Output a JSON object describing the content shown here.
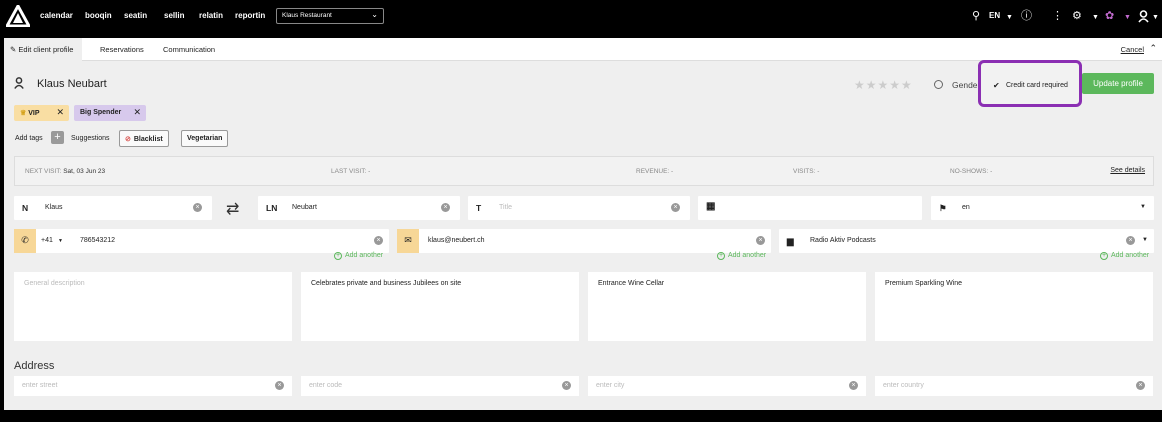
{
  "nav": {
    "items": [
      "calendar",
      "booqin",
      "seatin",
      "sellin",
      "relatin",
      "reportin"
    ],
    "restaurant": "Klaus Restaurant",
    "language": "EN",
    "icons": [
      "search-icon",
      "info-icon",
      "more-vertical-icon",
      "settings-icon",
      "flower-icon",
      "user-icon"
    ]
  },
  "tabs": {
    "edit": "Edit client profile",
    "reservations": "Reservations",
    "communication": "Communication",
    "cancel": "Cancel"
  },
  "client": {
    "name": "Klaus Neubart",
    "gender_label": "Gende",
    "credit_card_label": "Credit card required",
    "update_label": "Update profile",
    "rating": 0
  },
  "tags": {
    "items": [
      "VIP",
      "Big Spender"
    ],
    "add_label": "Add tags",
    "suggestions_label": "Suggestions",
    "suggestions": [
      "Blacklist",
      "Vegetarian"
    ]
  },
  "visits": {
    "next_label": "NEXT VISIT:",
    "next_value": "Sat, 03 Jun 23",
    "last_label": "LAST VISIT: -",
    "revenue_label": "REVENUE: -",
    "visits_label": "VISITS: -",
    "noshows_label": "NO-SHOWS: -",
    "details_link": "See details"
  },
  "fields": {
    "first_prefix": "N",
    "first_name": "Klaus",
    "last_prefix": "LN",
    "last_name": "Neubart",
    "title_prefix": "T",
    "title_placeholder": "Title",
    "language": "en",
    "phone_code": "+41",
    "phone": "786543212",
    "email": "klaus@neubert.ch",
    "company": "Radio Aktiv Podcasts",
    "add_another": "Add another"
  },
  "notes": {
    "general_placeholder": "General description",
    "note2": "Celebrates private and business Jubilees on site",
    "note3": "Entrance Wine Cellar",
    "note4": "Premium Sparkling Wine"
  },
  "address": {
    "heading": "Address",
    "street_ph": "enter street",
    "code_ph": "enter code",
    "city_ph": "enter city",
    "country_ph": "enter country"
  },
  "colors": {
    "accent_green": "#5cb85c",
    "highlight_purple": "#8b2fb3",
    "vip_tag": "#f9dea3",
    "spender_tag": "#d7c9ec"
  }
}
